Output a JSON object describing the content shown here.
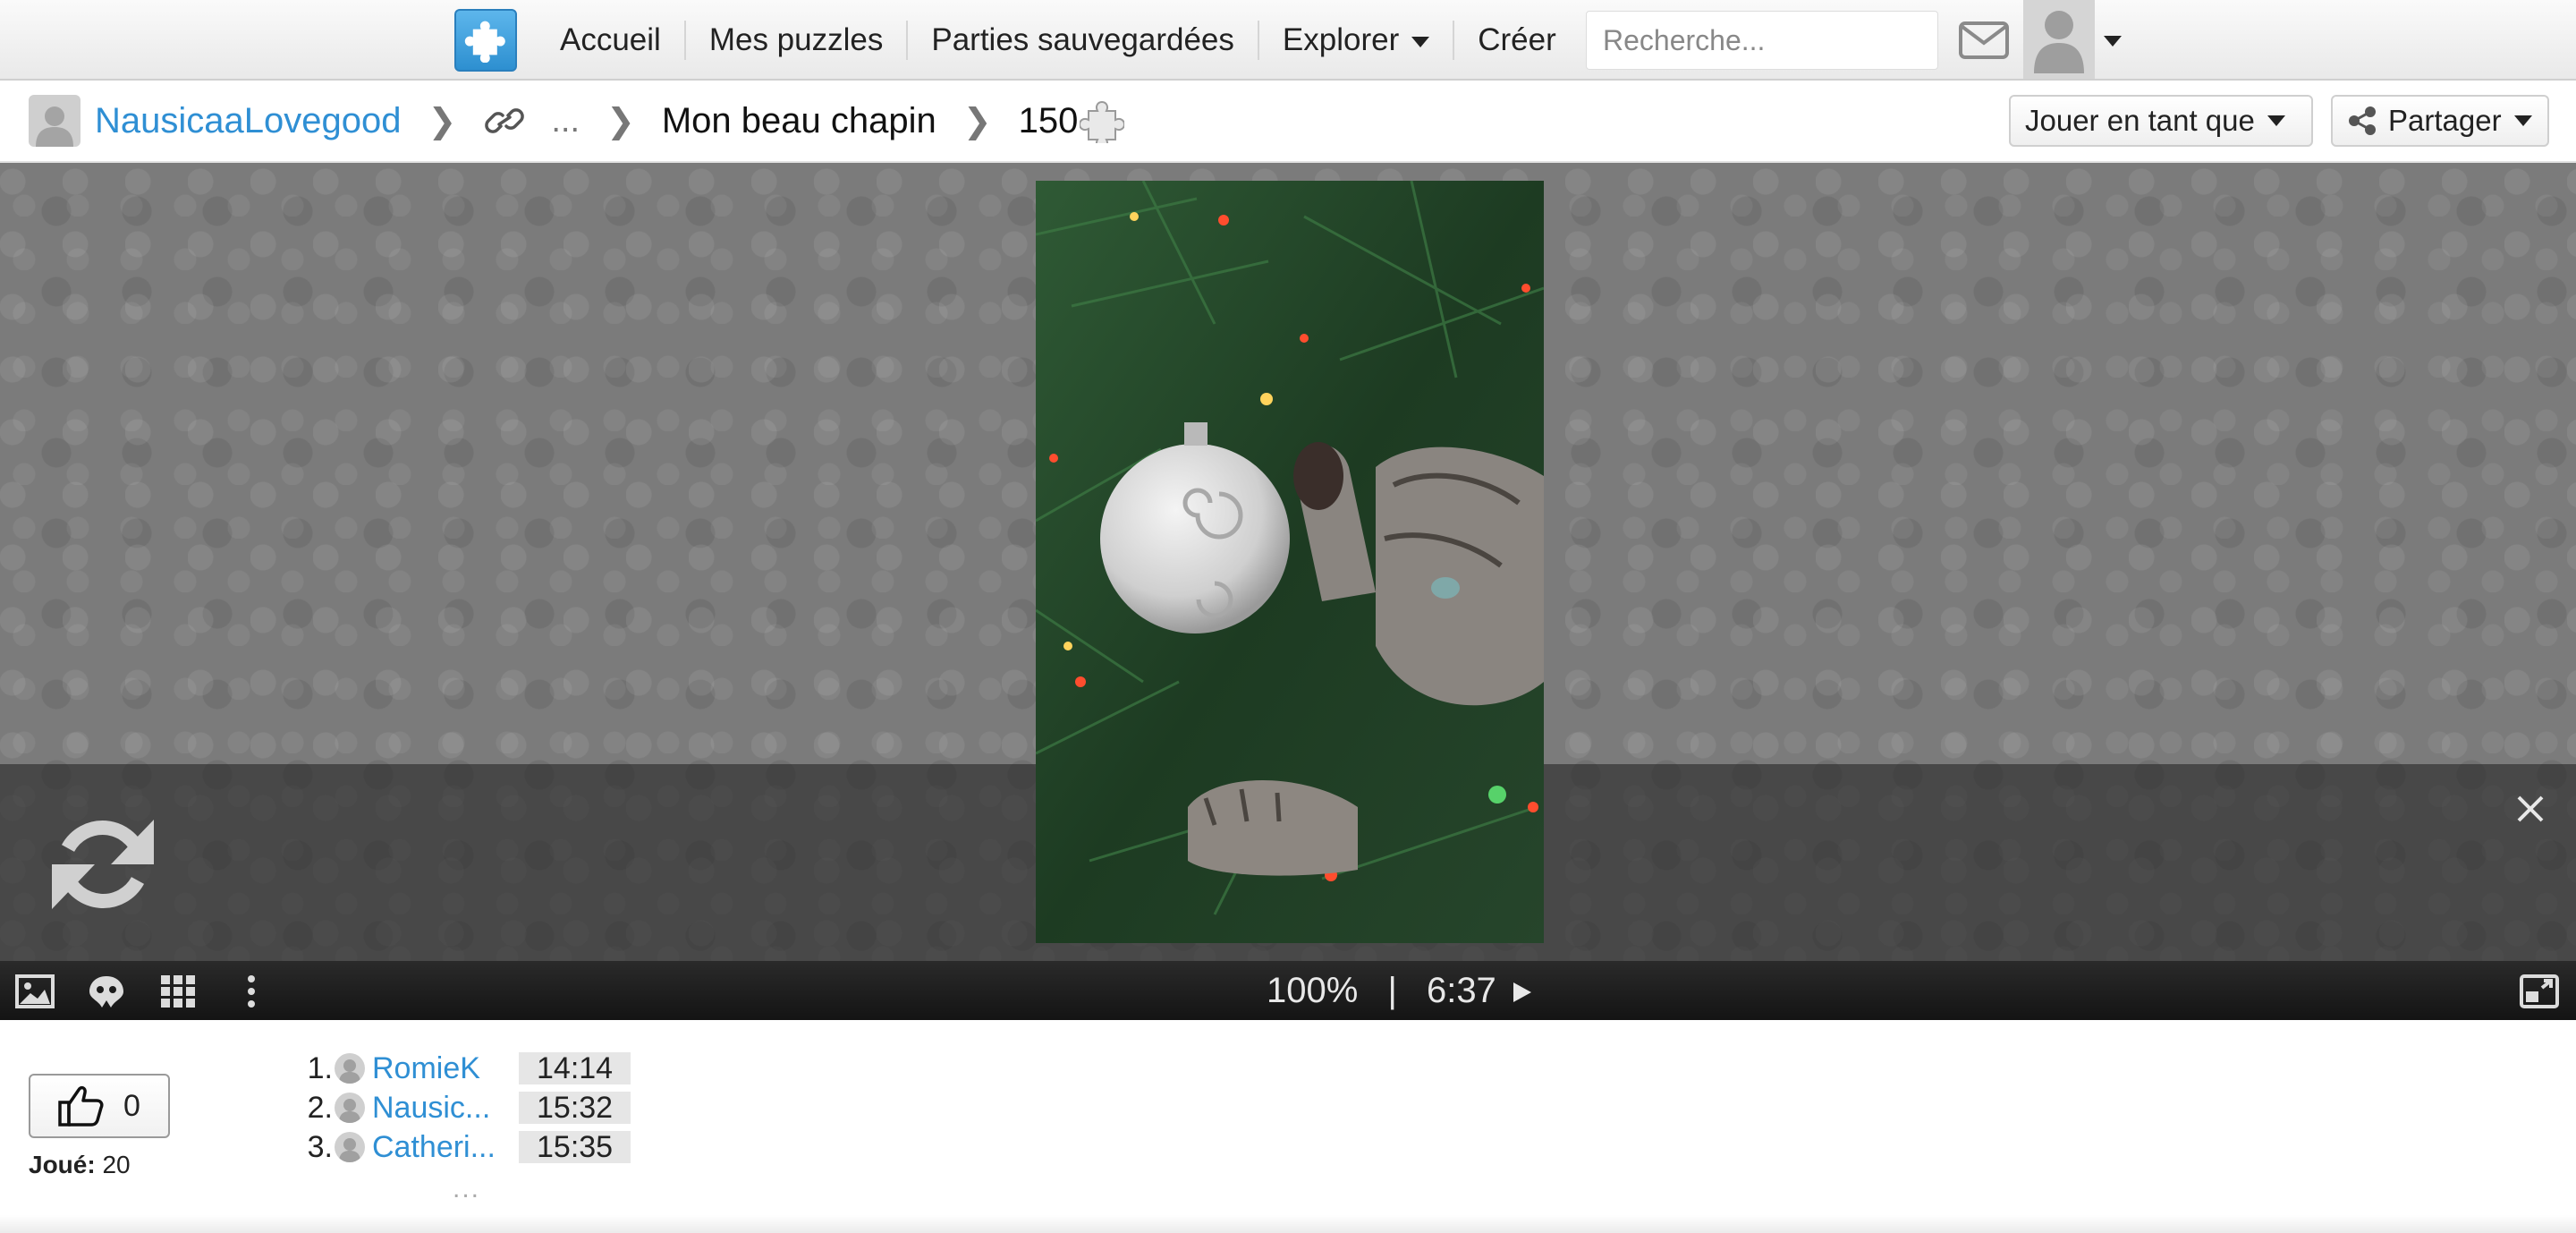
{
  "nav": {
    "items": [
      {
        "label": "Accueil"
      },
      {
        "label": "Mes puzzles"
      },
      {
        "label": "Parties sauvegardées"
      },
      {
        "label": "Explorer"
      },
      {
        "label": "Créer"
      }
    ],
    "search_placeholder": "Recherche..."
  },
  "breadcrumb": {
    "user": "NausicaaLovegood",
    "ellipsis": "...",
    "title": "Mon beau chapin",
    "pieces": "150"
  },
  "actions": {
    "play_as": "Jouer en tant que",
    "share": "Partager"
  },
  "player": {
    "zoom": "100%",
    "divider": "|",
    "time": "6:37"
  },
  "stats": {
    "likes": "0",
    "played_label": "Joué:",
    "played_count": "20"
  },
  "leaderboard": [
    {
      "rank": "1.",
      "name": "RomieK",
      "time": "14:14"
    },
    {
      "rank": "2.",
      "name": "Nausic...",
      "time": "15:32"
    },
    {
      "rank": "3.",
      "name": "Catheri...",
      "time": "15:35"
    }
  ],
  "leaderboard_more": "...",
  "colors": {
    "link": "#2f8fd4",
    "toolbar": "#1b1b1b",
    "stage": "#7b7b7b",
    "logo": "#3a9de0"
  }
}
